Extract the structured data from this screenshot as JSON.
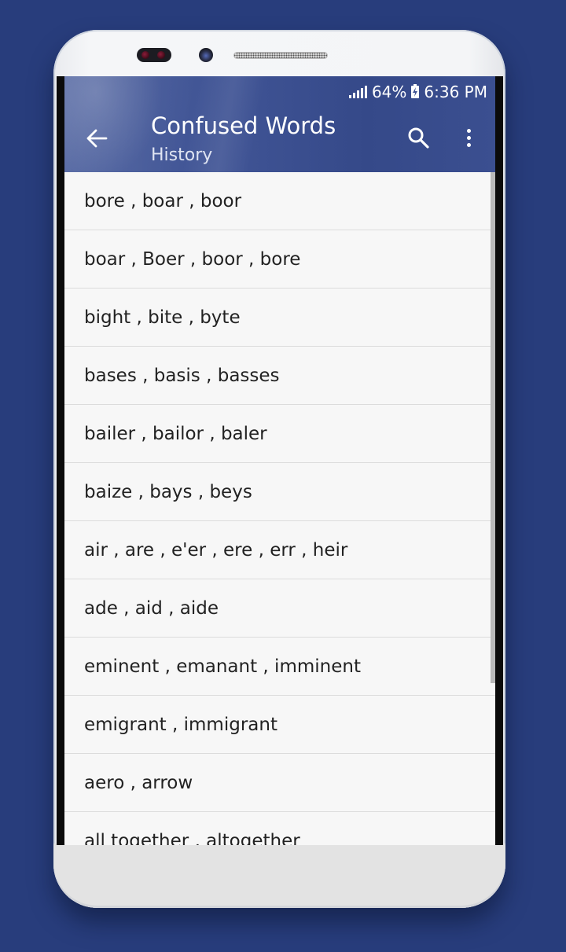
{
  "device": {
    "sensor_icon": "proximity-sensor",
    "camera_icon": "front-camera",
    "speaker_icon": "earpiece-speaker"
  },
  "status_bar": {
    "signal_icon": "cellular-signal-icon",
    "battery_percent": "64%",
    "battery_icon": "battery-charging-icon",
    "time": "6:36 PM"
  },
  "toolbar": {
    "back_icon": "arrow-left-icon",
    "title": "Confused Words",
    "subtitle": "History",
    "search_icon": "search-icon",
    "more_icon": "more-vertical-icon",
    "accent_color": "#3f5394"
  },
  "history": {
    "items": [
      "bore , boar , boor",
      "boar , Boer , boor , bore",
      "bight , bite , byte",
      "bases , basis , basses",
      "bailer , bailor , baler",
      "baize , bays , beys",
      "air , are , e'er , ere , err , heir",
      "ade , aid , aide",
      "eminent , emanant , imminent",
      "emigrant , immigrant",
      "aero , arrow",
      "all together , altogether"
    ]
  }
}
